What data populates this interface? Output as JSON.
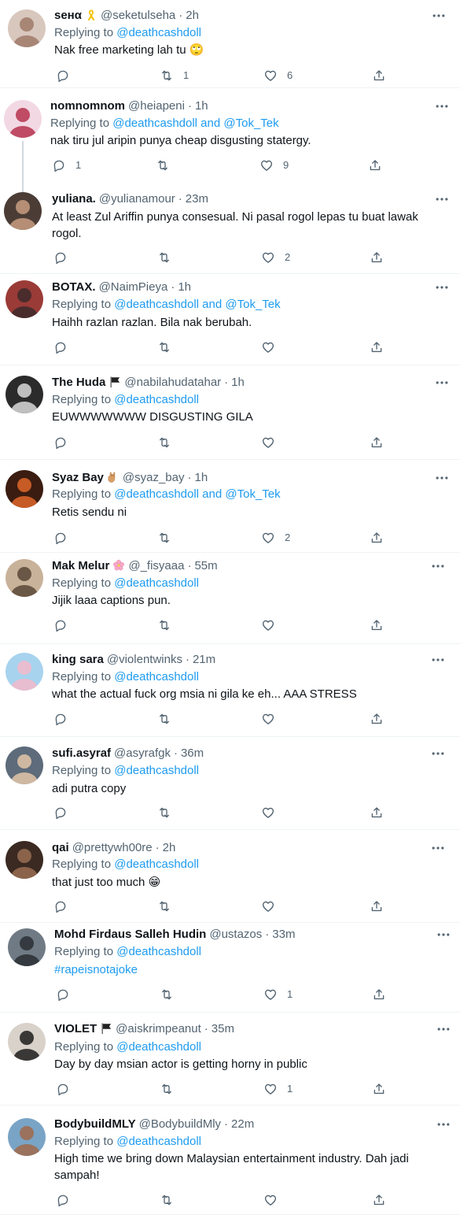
{
  "colors": {
    "link": "#1d9bf0",
    "muted": "#536471",
    "text": "#0f1419"
  },
  "feed": {
    "tweets": [
      {
        "display_name": "sенα",
        "badge": "ribbon-emoji",
        "handle": "@seketulseha",
        "dot": "·",
        "time": "2h",
        "replying_prefix": "Replying to ",
        "mentions": "@deathcashdoll",
        "text": "Nak free marketing lah tu 🙄",
        "text2": "",
        "counts": {
          "reply": "",
          "retweet": "1",
          "like": "6"
        }
      },
      {
        "display_name": "nomnomnom",
        "badge": "",
        "handle": "@heiapeni",
        "dot": "·",
        "time": "1h",
        "replying_prefix": "Replying to ",
        "mentions": "@deathcashdoll and @Tok_Tek",
        "text": "nak tiru jul aripin punya cheap disgusting statergy.",
        "text2": "",
        "counts": {
          "reply": "1",
          "retweet": "",
          "like": "9"
        }
      },
      {
        "display_name": "yuliana.",
        "badge": "",
        "handle": "@yulianamour",
        "dot": "·",
        "time": "23m",
        "replying_prefix": "",
        "mentions": "",
        "text": "At least Zul Ariffin punya consesual. Ni pasal rogol lepas tu buat lawak",
        "text2": "rogol.",
        "counts": {
          "reply": "",
          "retweet": "",
          "like": "2"
        }
      },
      {
        "display_name": "BOTAX.",
        "badge": "",
        "handle": "@NaimPieya",
        "dot": "·",
        "time": "1h",
        "replying_prefix": "Replying to ",
        "mentions": "@deathcashdoll and @Tok_Tek",
        "text": "Haihh razlan razlan. Bila nak berubah.",
        "text2": "",
        "counts": {
          "reply": "",
          "retweet": "",
          "like": ""
        }
      },
      {
        "display_name": "The Huda",
        "badge": "black-flag-emoji",
        "handle": "@nabilahudatahar",
        "dot": "·",
        "time": "1h",
        "replying_prefix": "Replying to ",
        "mentions": "@deathcashdoll",
        "text": "EUWWWWWWW DISGUSTING GILA",
        "text2": "",
        "counts": {
          "reply": "",
          "retweet": "",
          "like": ""
        }
      },
      {
        "display_name": "Syaz Bay",
        "badge": "rock-hand-emoji",
        "handle": "@syaz_bay",
        "dot": "·",
        "time": "1h",
        "replying_prefix": "Replying to ",
        "mentions": "@deathcashdoll and @Tok_Tek",
        "text": "Retis sendu ni",
        "text2": "",
        "counts": {
          "reply": "",
          "retweet": "",
          "like": "2"
        }
      },
      {
        "display_name": "Mak Melur",
        "badge": "cherry-blossom-emoji",
        "handle": "@_fisyaaa",
        "dot": "·",
        "time": "55m",
        "replying_prefix": "Replying to ",
        "mentions": "@deathcashdoll",
        "text": "Jijik laaa captions pun.",
        "text2": "",
        "counts": {
          "reply": "",
          "retweet": "",
          "like": ""
        }
      },
      {
        "display_name": "king sara",
        "badge": "",
        "handle": "@violentwinks",
        "dot": "·",
        "time": "21m",
        "replying_prefix": "Replying to ",
        "mentions": "@deathcashdoll",
        "text": "what the actual fuck org msia ni gila ke eh... AAA STRESS",
        "text2": "",
        "counts": {
          "reply": "",
          "retweet": "",
          "like": ""
        }
      },
      {
        "display_name": "sufi.asyraf",
        "badge": "",
        "handle": "@asyrafgk",
        "dot": "·",
        "time": "36m",
        "replying_prefix": "Replying to ",
        "mentions": "@deathcashdoll",
        "text": "adi putra copy",
        "text2": "",
        "counts": {
          "reply": "",
          "retweet": "",
          "like": ""
        }
      },
      {
        "display_name": "qai",
        "badge": "",
        "handle": "@prettywh00re",
        "dot": "·",
        "time": "2h",
        "replying_prefix": "Replying to ",
        "mentions": "@deathcashdoll",
        "text": "that just too much 😁",
        "text2": "",
        "counts": {
          "reply": "",
          "retweet": "",
          "like": ""
        }
      },
      {
        "display_name": "Mohd Firdaus Salleh Hudin",
        "badge": "",
        "handle": "@ustazos",
        "dot": "·",
        "time": "33m",
        "replying_prefix": "Replying to ",
        "mentions": "@deathcashdoll",
        "text": "#rapeisnotajoke",
        "text2": "",
        "counts": {
          "reply": "",
          "retweet": "",
          "like": "1"
        }
      },
      {
        "display_name": "VIOLET",
        "badge": "black-flag-emoji",
        "handle": "@aiskrimpeanut",
        "dot": "·",
        "time": "35m",
        "replying_prefix": "Replying to ",
        "mentions": "@deathcashdoll",
        "text": "Day by day msian actor is getting horny in public",
        "text2": "",
        "counts": {
          "reply": "",
          "retweet": "",
          "like": "1"
        }
      },
      {
        "display_name": "BodybuildMLY",
        "badge": "",
        "handle": "@BodybuildMly",
        "dot": "·",
        "time": "22m",
        "replying_prefix": "Replying to ",
        "mentions": "@deathcashdoll",
        "text": "High time we bring down Malaysian entertainment industry. Dah jadi",
        "text2": "sampah!",
        "counts": {
          "reply": "",
          "retweet": "",
          "like": ""
        }
      }
    ]
  }
}
